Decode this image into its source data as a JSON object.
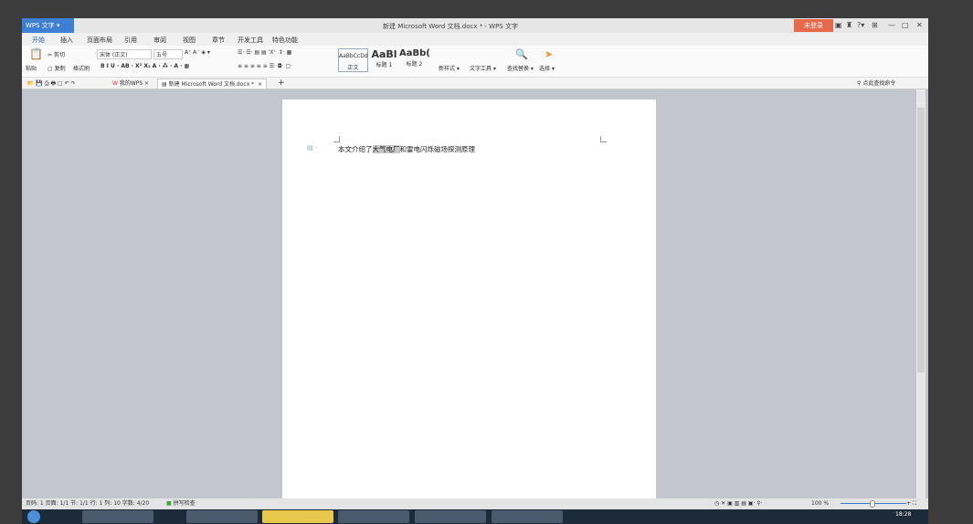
{
  "app": {
    "name": "WPS 文字",
    "title": "新建 Microsoft Word 文档.docx * - WPS 文字",
    "login": "未登录"
  },
  "menu_tabs": [
    "开始",
    "插入",
    "页面布局",
    "引用",
    "审阅",
    "视图",
    "章节",
    "开发工具",
    "特色功能"
  ],
  "ribbon": {
    "paste": "粘贴",
    "cut": "剪切",
    "copy": "复制",
    "format_painter": "格式刷",
    "font": "宋体 (正文)",
    "size": "五号",
    "styles": [
      {
        "preview": "AaBbCcDd",
        "label": "正文"
      },
      {
        "preview": "AaBl",
        "label": "标题 1"
      },
      {
        "preview": "AaBb(",
        "label": "标题 2"
      }
    ],
    "new_style": "新样式",
    "text_tools": "文字工具",
    "find_replace": "查找替换",
    "select": "选择"
  },
  "doc_tabs": [
    {
      "label": "我的WPS"
    },
    {
      "label": "新建 Microsoft Word 文档.docx *"
    }
  ],
  "search_command": "点此查找命令",
  "document": {
    "before": "本文介绍了",
    "highlight": "大气电厂",
    "after": "和雷电闪烁磁场探测原理"
  },
  "status": {
    "text": "页码: 1  页面: 1/1  节: 1/1  行: 1  列: 10  字数: 4/20",
    "spell": "拼写检查",
    "zoom": "100 %"
  },
  "taskbar": {
    "time": "18:28"
  },
  "colors": {
    "accent": "#3c7fd4",
    "login": "#e8694a"
  }
}
